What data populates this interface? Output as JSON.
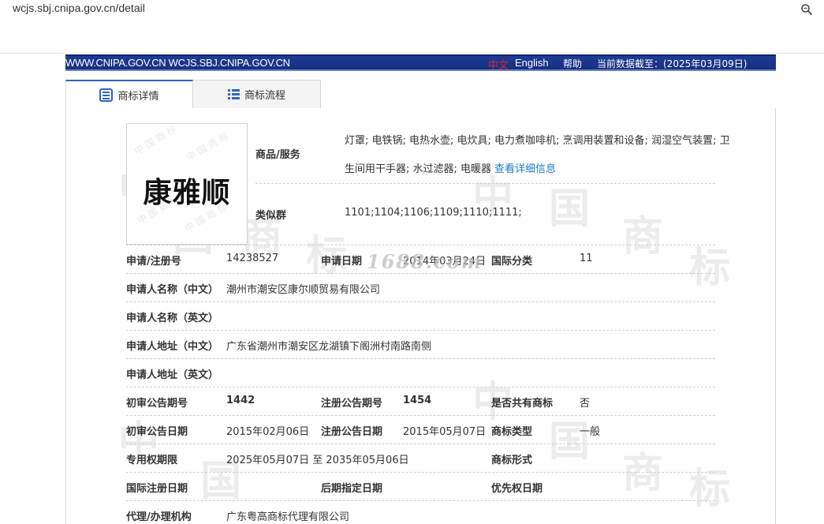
{
  "browser": {
    "url": "wcjs.sbj.cnipa.gov.cn/detail",
    "zoom_icon": "zoom-icon"
  },
  "header": {
    "domains": "WWW.CNIPA.GOV.CN WCJS.SBJ.CNIPA.GOV.CN",
    "lang_zh": "中文",
    "lang_en": "English",
    "help": "帮助",
    "data_as_of": "当前数据截至：(2025年03月09日)",
    "colors": {
      "bar": "#1f3b95",
      "lang_zh": "#e0241f"
    }
  },
  "tabs": [
    {
      "label": "商标详情",
      "icon": "document-icon",
      "active": true
    },
    {
      "label": "商标流程",
      "icon": "list-icon",
      "active": false
    }
  ],
  "trademark": {
    "image_text": "康雅顺",
    "goods_label": "商品/服务",
    "goods_line1": "灯罩; 电铁锅; 电热水壶; 电炊具; 电力煮咖啡机; 烹调用装置和设备; 润湿空气装置; 卫",
    "goods_line2": "生间用干手器; 水过滤器; 电暖器",
    "goods_more_link": "查看详细信息",
    "similar_group_label": "类似群",
    "similar_group": "1101;1104;1106;1109;1110;1111;"
  },
  "fields": {
    "reg_no_label": "申请/注册号",
    "reg_no": "14238527",
    "app_date_label": "申请日期",
    "app_date": "2014年03月24日",
    "intl_class_label": "国际分类",
    "intl_class": "11",
    "applicant_cn_label": "申请人名称（中文）",
    "applicant_cn": "潮州市潮安区康尔顺贸易有限公司",
    "applicant_en_label": "申请人名称（英文）",
    "applicant_en": "",
    "address_cn_label": "申请人地址（中文）",
    "address_cn": "广东省潮州市潮安区龙湖镇下阁洲村南路南侧",
    "address_en_label": "申请人地址（英文）",
    "address_en": "",
    "prelim_no_label": "初审公告期号",
    "prelim_no": "1442",
    "reg_pub_no_label": "注册公告期号",
    "reg_pub_no": "1454",
    "shared_label": "是否共有商标",
    "shared": "否",
    "prelim_date_label": "初审公告日期",
    "prelim_date": "2015年02月06日",
    "reg_pub_date_label": "注册公告日期",
    "reg_pub_date": "2015年05月07日",
    "mark_type_label": "商标类型",
    "mark_type": "一般",
    "exclusive_label": "专用权期限",
    "exclusive": "2025年05月07日 至 2035年05月06日",
    "mark_form_label": "商标形式",
    "mark_form": "",
    "intl_reg_date_label": "国际注册日期",
    "intl_reg_date": "",
    "later_date_label": "后期指定日期",
    "later_date": "",
    "priority_label": "优先权日期",
    "priority": "",
    "agent_label": "代理/办理机构",
    "agent": "广东粤高商标代理有限公司"
  },
  "watermark_1688": "1688.com"
}
